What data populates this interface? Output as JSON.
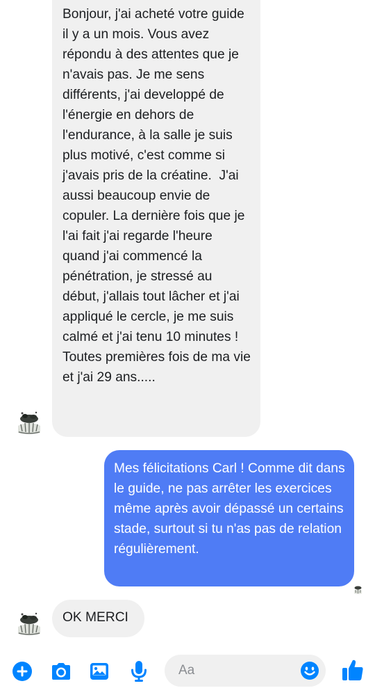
{
  "conversation": {
    "messages": [
      {
        "sender": "incoming",
        "text": "Bonjour, j'ai acheté votre guide il y a un mois. Vous avez répondu à des attentes que je n'avais pas. Je me sens différents, j'ai developpé de l'énergie en dehors de l'endurance, à la salle je suis plus motivé, c'est comme si j'avais pris de la créatine.  J'ai aussi beaucoup envie de copuler. La dernière fois que je l'ai fait j'ai regarde l'heure quand j'ai commencé la pénétration, je stressé au début, j'allais tout lâcher et j'ai appliqué le cercle, je me suis calmé et j'ai tenu 10 minutes ! Toutes premières fois de ma vie et j'ai 29 ans....."
      },
      {
        "sender": "outgoing",
        "text": "Mes félicitations Carl ! Comme dit dans le guide, ne pas arrêter les exercices même après avoir dépassé un certains stade, surtout si tu n'as pas de relation régulièrement."
      },
      {
        "sender": "incoming",
        "text": "OK MERCI"
      }
    ]
  },
  "composer": {
    "placeholder": "Aa",
    "icons": [
      "add-icon",
      "camera-icon",
      "gallery-icon",
      "microphone-icon",
      "emoji-icon",
      "thumbs-up-icon"
    ]
  },
  "colors": {
    "accent": "#0084ff",
    "outgoing_bubble": "#4f7cf5",
    "incoming_bubble": "#f0f0f0"
  }
}
